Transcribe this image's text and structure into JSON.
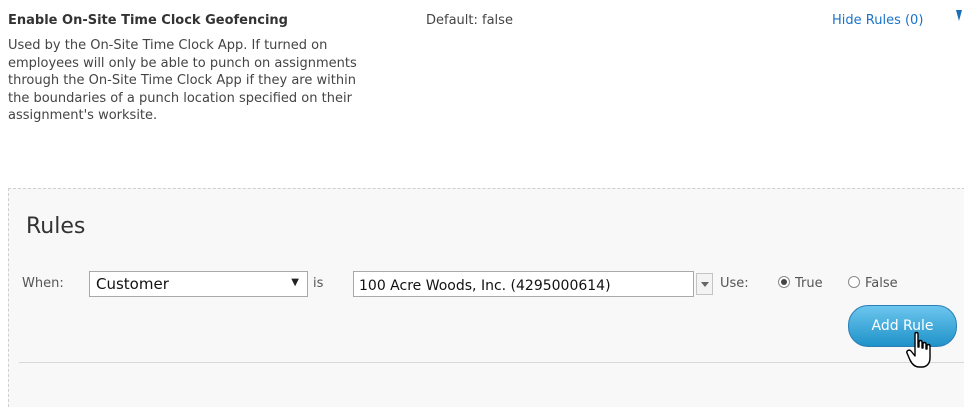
{
  "setting": {
    "title": "Enable On-Site Time Clock Geofencing",
    "description": "Used by the On-Site Time Clock App. If turned on employees will only be able to punch on assignments through the On-Site Time Clock App if they are within the boundaries of a punch location specified on their assignment's worksite.",
    "default_text": "Default: false",
    "hide_rules_label": "Hide Rules (0)"
  },
  "rules": {
    "heading": "Rules",
    "when_label": "When:",
    "field_select": {
      "value": "Customer"
    },
    "is_label": "is",
    "value_input": {
      "value": "100 Acre Woods, Inc. (4295000614)"
    },
    "use_label": "Use:",
    "options": [
      {
        "label": "True",
        "checked": true
      },
      {
        "label": "False",
        "checked": false
      }
    ],
    "add_button_label": "Add Rule"
  }
}
